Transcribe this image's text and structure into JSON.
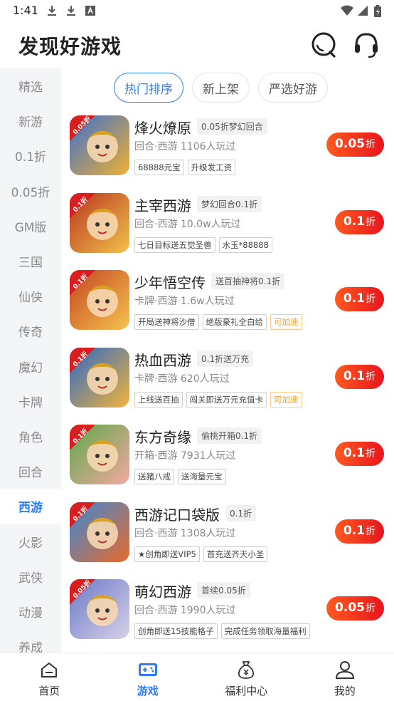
{
  "status_bar": {
    "time": "1:41"
  },
  "header": {
    "title": "发现好游戏"
  },
  "sidebar": {
    "items": [
      "精选",
      "新游",
      "0.1折",
      "0.05折",
      "GM版",
      "三国",
      "仙侠",
      "传奇",
      "魔幻",
      "卡牌",
      "角色",
      "回合",
      "西游",
      "火影",
      "武侠",
      "动漫",
      "养成"
    ],
    "active_index": 12
  },
  "tabs": {
    "items": [
      "热门排序",
      "新上架",
      "严选好游"
    ],
    "active_index": 0
  },
  "games": [
    {
      "name": "烽火燎原",
      "promo": "0.05折梦幻回合",
      "meta": "回合·西游 1106人玩过",
      "tags": [
        "68888元宝",
        "升级发工资"
      ],
      "orange_tag": "",
      "discount": "0.05",
      "unit": "折",
      "icon_label": "0.05折",
      "icon_colors": [
        "#3a6fd1",
        "#f0b030"
      ]
    },
    {
      "name": "主宰西游",
      "promo": "梦幻回合0.1折",
      "meta": "回合·西游 10.0w人玩过",
      "tags": [
        "七日目标送五觉圣兽",
        "水玉*88888"
      ],
      "orange_tag": "",
      "discount": "0.1",
      "unit": "折",
      "icon_label": "0.1折",
      "icon_colors": [
        "#b8351f",
        "#f2c14a"
      ]
    },
    {
      "name": "少年悟空传",
      "promo": "送百抽神将0.1折",
      "meta": "卡牌·西游 1.6w人玩过",
      "tags": [
        "开局送神将沙僧",
        "绝版豪礼全白给"
      ],
      "orange_tag": "可加速",
      "discount": "0.1",
      "unit": "折",
      "icon_label": "0.1折",
      "icon_colors": [
        "#c4451f",
        "#f6c350"
      ]
    },
    {
      "name": "热血西游",
      "promo": "0.1折送万充",
      "meta": "卡牌·西游 620人玩过",
      "tags": [
        "上线送百抽",
        "闯关即送万元充值卡"
      ],
      "orange_tag": "可加速",
      "discount": "0.1",
      "unit": "折",
      "icon_label": "0.1折",
      "icon_colors": [
        "#2a68c8",
        "#f2b43a"
      ]
    },
    {
      "name": "东方奇缘",
      "promo": "偷桃开箱0.1折",
      "meta": "开箱·西游 7931人玩过",
      "tags": [
        "送猪八戒",
        "送海量元宝"
      ],
      "orange_tag": "",
      "discount": "0.1",
      "unit": "折",
      "icon_label": "0.1折",
      "icon_colors": [
        "#5aa84a",
        "#f4a8a0"
      ]
    },
    {
      "name": "西游记口袋版",
      "promo": "0.1折",
      "meta": "回合·西游 1308人玩过",
      "tags": [
        "★创角即送VIP5",
        "首充送齐天小圣"
      ],
      "orange_tag": "",
      "discount": "0.1",
      "unit": "折",
      "icon_label": "0.1折",
      "icon_colors": [
        "#3a88d8",
        "#e86a2a"
      ]
    },
    {
      "name": "萌幻西游",
      "promo": "首续0.05折",
      "meta": "回合·西游 1990人玩过",
      "tags": [
        "创角即送15技能格子",
        "完成任务领取海量福利"
      ],
      "orange_tag": "",
      "discount": "0.05",
      "unit": "折",
      "icon_label": "0.05折",
      "icon_colors": [
        "#6a7ac8",
        "#d8d0e8"
      ]
    }
  ],
  "bottom_nav": {
    "items": [
      {
        "label": "首页",
        "icon": "home-icon"
      },
      {
        "label": "游戏",
        "icon": "gamepad-icon"
      },
      {
        "label": "福利中心",
        "icon": "money-bag-icon"
      },
      {
        "label": "我的",
        "icon": "profile-icon"
      }
    ],
    "active_index": 1
  },
  "colors": {
    "accent": "#2f7df6",
    "discount_start": "#ff5a1f",
    "discount_end": "#e8141f",
    "orange_tag": "#ff9a1f"
  }
}
